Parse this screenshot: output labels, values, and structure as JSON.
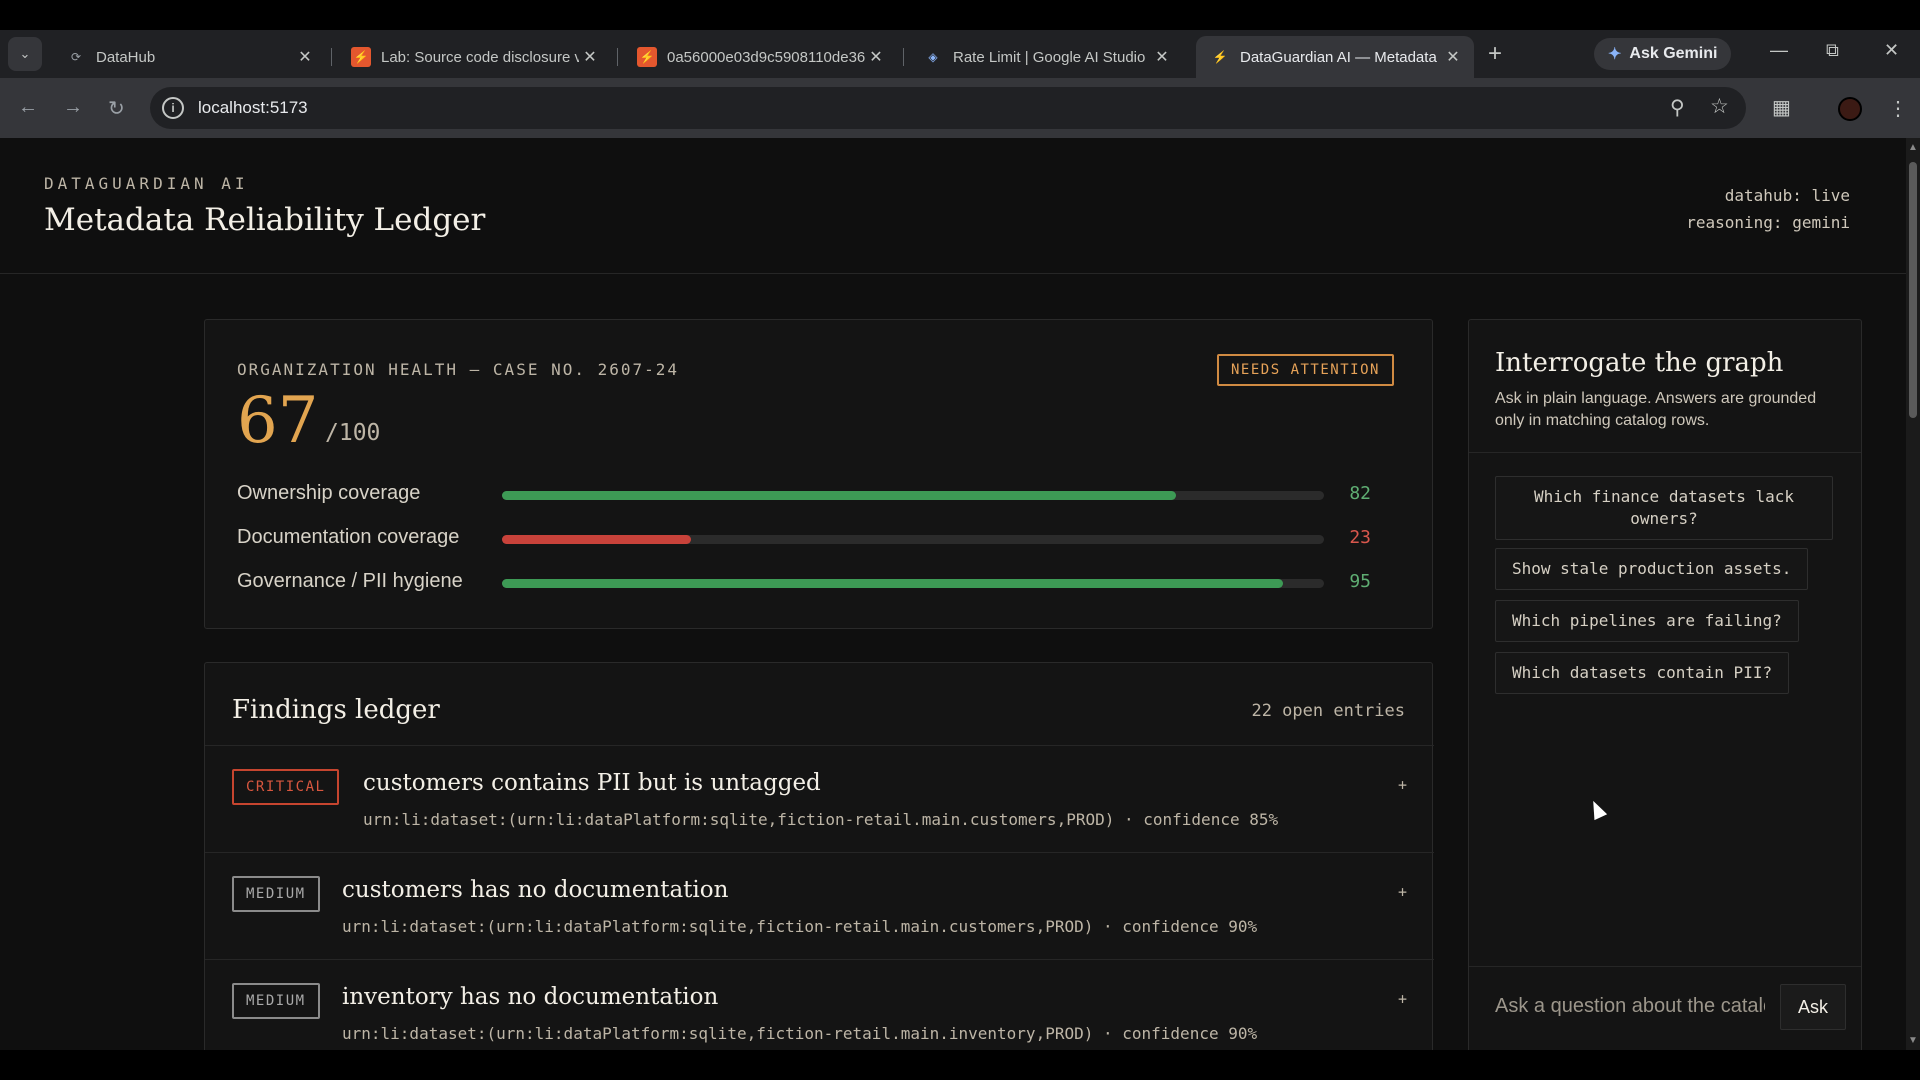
{
  "browser": {
    "tabs": [
      {
        "title": "DataHub",
        "icon": "datahub-favicon"
      },
      {
        "title": "Lab: Source code disclosure v",
        "icon": "portswigger-favicon"
      },
      {
        "title": "0a56000e03d9c5908110de36",
        "icon": "portswigger-favicon"
      },
      {
        "title": "Rate Limit | Google AI Studio",
        "icon": "ai-studio-favicon"
      },
      {
        "title": "DataGuardian AI — Metadata",
        "icon": "dataguardian-favicon"
      }
    ],
    "gemini_label": "Ask Gemini",
    "url": "localhost:5173"
  },
  "header": {
    "brand": "DATAGUARDIAN AI",
    "title": "Metadata Reliability Ledger",
    "status_line1": "datahub: live",
    "status_line2": "reasoning: gemini"
  },
  "health": {
    "case_label": "ORGANIZATION HEALTH — CASE NO. 2607-24",
    "badge": "NEEDS ATTENTION",
    "score": "67",
    "score_max": "/100",
    "metrics": [
      {
        "label": "Ownership coverage",
        "value": "82",
        "fraction": 0.82,
        "color": "#3d9a55",
        "value_color": "#5fae73"
      },
      {
        "label": "Documentation coverage",
        "value": "23",
        "fraction": 0.23,
        "color": "#c8423a",
        "value_color": "#d9574d"
      },
      {
        "label": "Governance / PII hygiene",
        "value": "95",
        "fraction": 0.95,
        "color": "#3d9a55",
        "value_color": "#5fae73"
      }
    ]
  },
  "findings": {
    "title": "Findings ledger",
    "count": "22 open entries",
    "rows": [
      {
        "severity": "CRITICAL",
        "title": "customers contains PII but is untagged",
        "urn": "urn:li:dataset:(urn:li:dataPlatform:sqlite,fiction-retail.main.customers,PROD) · confidence 85%",
        "expand": "+"
      },
      {
        "severity": "MEDIUM",
        "title": "customers has no documentation",
        "urn": "urn:li:dataset:(urn:li:dataPlatform:sqlite,fiction-retail.main.customers,PROD) · confidence 90%",
        "expand": "+"
      },
      {
        "severity": "MEDIUM",
        "title": "inventory has no documentation",
        "urn": "urn:li:dataset:(urn:li:dataPlatform:sqlite,fiction-retail.main.inventory,PROD) · confidence 90%",
        "expand": "+"
      }
    ]
  },
  "ask": {
    "title": "Interrogate the graph",
    "description": "Ask in plain language. Answers are grounded only in matching catalog rows.",
    "suggestions": [
      "Which finance datasets lack owners?",
      "Show stale production assets.",
      "Which pipelines are failing?",
      "Which datasets contain PII?"
    ],
    "placeholder": "Ask a question about the catalog",
    "button": "Ask"
  }
}
